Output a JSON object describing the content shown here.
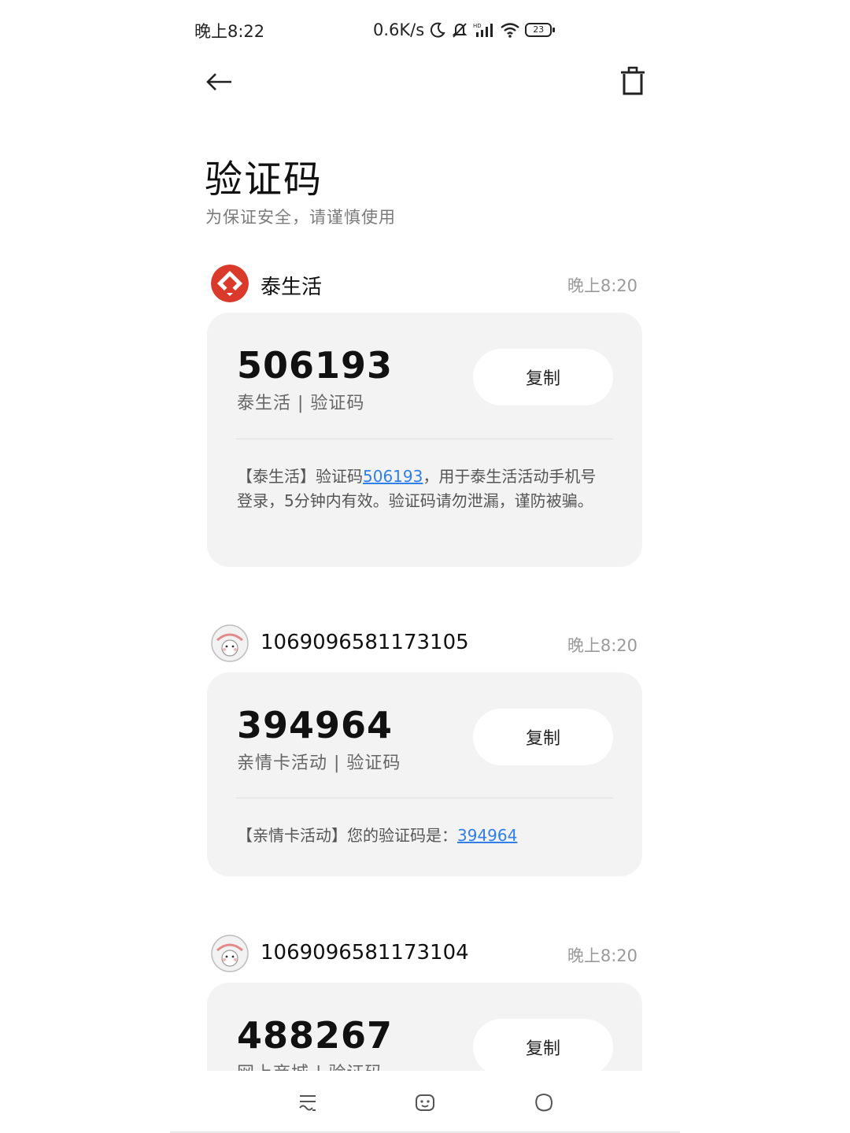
{
  "status_bar": {
    "time": "晚上8:22",
    "net_speed": "0.6K/s",
    "battery": "23"
  },
  "header": {
    "title": "验证码",
    "subtitle": "为保证安全，请谨慎使用"
  },
  "messages": [
    {
      "sender": "泰生活",
      "time": "晚上8:20",
      "code": "506193",
      "label": "泰生活 | 验证码",
      "copy_label": "复制",
      "body_before": "【泰生活】验证码",
      "body_code": "506193",
      "body_after": "，用于泰生活活动手机号登录，5分钟内有效。验证码请勿泄漏，谨防被骗。"
    },
    {
      "sender": "1069096581173105",
      "time": "晚上8:20",
      "code": "394964",
      "label": "亲情卡活动 | 验证码",
      "copy_label": "复制",
      "body_before": "【亲情卡活动】您的验证码是：",
      "body_code": "394964",
      "body_after": ""
    },
    {
      "sender": "1069096581173104",
      "time": "晚上8:20",
      "code": "488267",
      "label": "网上商城 | 验证码",
      "copy_label": "复制"
    }
  ],
  "colors": {
    "accent_link": "#2f7fe6",
    "card_bg": "#f3f3f3",
    "brand_red": "#d93a2b"
  },
  "icons": [
    "back-arrow-icon",
    "trash-icon",
    "moon-icon",
    "mute-bell-icon",
    "signal-icon",
    "wifi-icon",
    "battery-icon",
    "messages-icon",
    "contacts-icon",
    "favorites-icon"
  ]
}
